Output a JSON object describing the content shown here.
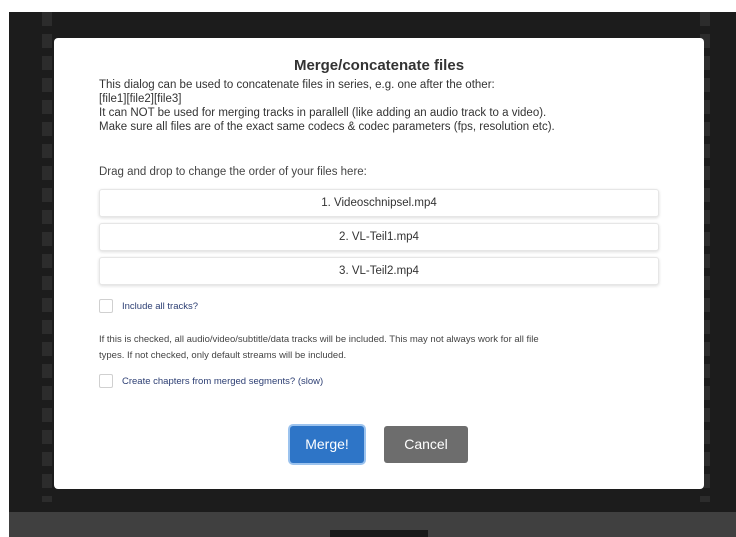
{
  "dialog": {
    "title": "Merge/concatenate files",
    "description": [
      "This dialog can be used to concatenate files in series, e.g. one after the other:",
      "[file1][file2][file3]",
      "It can NOT be used for merging tracks in parallell (like adding an audio track to a video).",
      "Make sure all files are of the exact same codecs & codec parameters (fps, resolution etc)."
    ],
    "drag_label": "Drag and drop to change the order of your files here:",
    "files": [
      "1. Videoschnipsel.mp4",
      "2. VL-Teil1.mp4",
      "3. VL-Teil2.mp4"
    ],
    "include_tracks": {
      "label": "Include all tracks?",
      "checked": false
    },
    "info_text": [
      "If this is checked, all audio/video/subtitle/data tracks will be included. This may not always work for all file",
      "types. If not checked, only default streams will be included."
    ],
    "create_chapters": {
      "label": "Create chapters from merged segments? (slow)",
      "checked": false
    },
    "merge_label": "Merge!",
    "cancel_label": "Cancel"
  },
  "colors": {
    "merge_button": "#2e75c7",
    "cancel_button": "#6d6d6d",
    "checkbox_label": "#2c3e73"
  }
}
